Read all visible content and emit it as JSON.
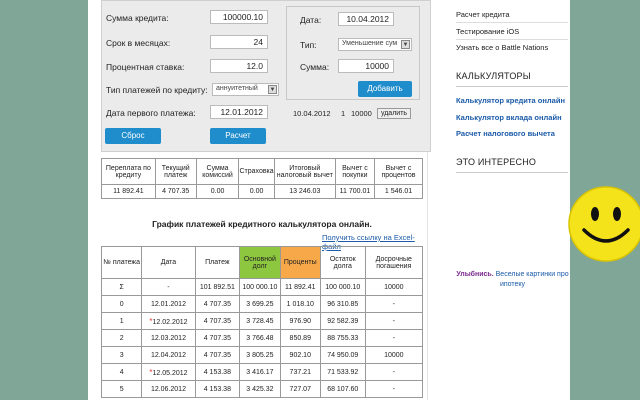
{
  "calc": {
    "amount_label": "Сумма кредита:",
    "amount_value": "100000.10",
    "term_label": "Срок в месяцах:",
    "term_value": "24",
    "rate_label": "Процентная ставка:",
    "rate_value": "12.0",
    "type_label": "Тип платежей по кредиту:",
    "type_value": "аннуитетный",
    "first_label": "Дата первого платежа:",
    "first_value": "12.01.2012",
    "reset_label": "Сброс",
    "calc_label": "Расчет"
  },
  "prepay": {
    "date_label": "Дата:",
    "date_value": "10.04.2012",
    "type_label": "Тип:",
    "type_value": "Уменьшение сум",
    "sum_label": "Сумма:",
    "sum_value": "10000",
    "add_label": "Добавить",
    "list_date": "10.04.2012",
    "list_num": "1",
    "list_sum": "10000",
    "remove_label": "удалить"
  },
  "summary": {
    "headers": [
      "Переплата по кредиту",
      "Текущий платеж",
      "Сумма комиссий",
      "Страховка",
      "Итоговый налоговый вычет",
      "Вычет с покупки",
      "Вычет с процентов"
    ],
    "values": [
      "11 892.41",
      "4 707.35",
      "0.00",
      "0.00",
      "13 246.03",
      "11 700.01",
      "1 546.01"
    ]
  },
  "schedule": {
    "title": "График платежей кредитного калькулятора онлайн.",
    "excel_link": "Получить ссылку на Excel-файл",
    "headers": [
      "№ платежа",
      "Дата",
      "Платеж",
      "Основной долг",
      "Проценты",
      "Остаток долга",
      "Досрочные погашения"
    ],
    "rows": [
      [
        "Σ",
        "-",
        "101 892.51",
        "100 000.10",
        "11 892.41",
        "100 000.10",
        "10000"
      ],
      [
        "0",
        "12.01.2012",
        "4 707.35",
        "3 699.25",
        "1 018.10",
        "96 310.85",
        "-"
      ],
      [
        "1",
        "12.02.2012",
        "4 707.35",
        "3 728.45",
        "976.90",
        "92 582.39",
        "-"
      ],
      [
        "2",
        "12.03.2012",
        "4 707.35",
        "3 766.48",
        "850.89",
        "88 755.33",
        "-"
      ],
      [
        "3",
        "12.04.2012",
        "4 707.35",
        "3 805.25",
        "902.10",
        "74 950.09",
        "10000"
      ],
      [
        "4",
        "12.05.2012",
        "4 153.38",
        "3 416.17",
        "737.21",
        "71 533.92",
        "-"
      ],
      [
        "5",
        "12.06.2012",
        "4 153.38",
        "3 425.32",
        "727.07",
        "68 107.60",
        "-"
      ]
    ]
  },
  "sidebar": {
    "links_top": [
      "Расчет кредита",
      "Тестирование iOS",
      "Узнать все о Battle Nations"
    ],
    "calc_head": "КАЛЬКУЛЯТОРЫ",
    "calc_links": [
      "Калькулятор кредита онлайн",
      "Калькулятор вклада онлайн",
      "Расчет налогового вычета"
    ],
    "interest_head": "ЭТО ИНТЕРЕСНО",
    "caption_bold": "Улыбнись.",
    "caption_rest": " Веселые картинки про ипотеку"
  },
  "colors": {
    "background": "#7fa696",
    "button_blue": "#1f8ccc",
    "principal_green": "#8dc63f",
    "interest_orange": "#f7a94a",
    "smiley_yellow": "#f4e21a"
  }
}
